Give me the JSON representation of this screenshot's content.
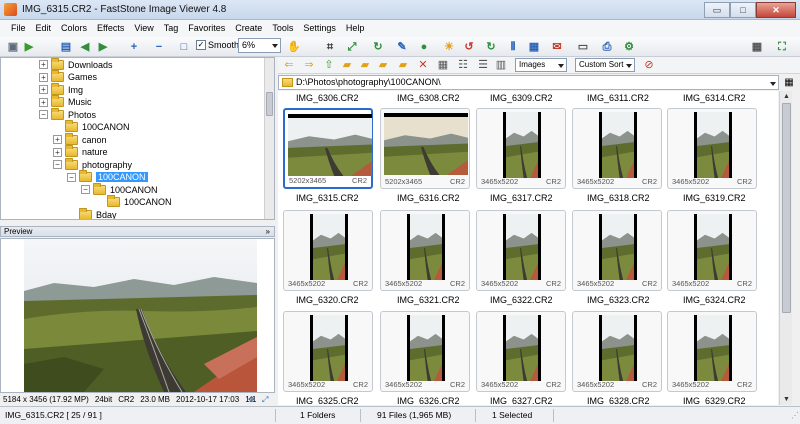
{
  "window": {
    "title": "IMG_6315.CR2  -  FastStone Image Viewer 4.8",
    "controls": {
      "minimize": "▭",
      "maximize": "□",
      "close": "✕"
    }
  },
  "menu": [
    "File",
    "Edit",
    "Colors",
    "Effects",
    "View",
    "Tag",
    "Favorites",
    "Create",
    "Tools",
    "Settings",
    "Help"
  ],
  "toolbar": {
    "smooth_label": "Smooth",
    "smooth_checked": true,
    "zoom_value": "6%"
  },
  "tree": {
    "items": [
      {
        "label": "Downloads",
        "depth": 0,
        "expander": "+"
      },
      {
        "label": "Games",
        "depth": 0,
        "expander": "+"
      },
      {
        "label": "Img",
        "depth": 0,
        "expander": "+"
      },
      {
        "label": "Music",
        "depth": 0,
        "expander": "+"
      },
      {
        "label": "Photos",
        "depth": 0,
        "expander": "−"
      },
      {
        "label": "100CANON",
        "depth": 1,
        "expander": ""
      },
      {
        "label": "canon",
        "depth": 1,
        "expander": "+"
      },
      {
        "label": "nature",
        "depth": 1,
        "expander": "+"
      },
      {
        "label": "photography",
        "depth": 1,
        "expander": "−"
      },
      {
        "label": "100CANON",
        "depth": 2,
        "expander": "−",
        "selected": true
      },
      {
        "label": "100CANON",
        "depth": 3,
        "expander": "−"
      },
      {
        "label": "100CANON",
        "depth": 4,
        "expander": ""
      },
      {
        "label": "Bday",
        "depth": 2,
        "expander": ""
      }
    ]
  },
  "preview": {
    "header": "Preview",
    "collapse_glyph": "»",
    "info": [
      "5184 x 3456 (17.92 MP)",
      "24bit",
      "CR2",
      "23.0 MB",
      "2012-10-17 17:03",
      "1:1"
    ]
  },
  "browser": {
    "filter_value": "Images",
    "sort_value": "Custom Sort",
    "path": "D:\\Photos\\photography\\100CANON\\",
    "top_labels": [
      "IMG_6306.CR2",
      "IMG_6308.CR2",
      "IMG_6309.CR2",
      "IMG_6311.CR2",
      "IMG_6314.CR2"
    ],
    "rows": [
      {
        "cells": [
          {
            "dims": "5202x3465",
            "ext": "CR2",
            "orient": "landscape",
            "selected": true
          },
          {
            "dims": "5202x3465",
            "ext": "CR2",
            "orient": "landscape"
          },
          {
            "dims": "3465x5202",
            "ext": "CR2",
            "orient": "portrait"
          },
          {
            "dims": "3465x5202",
            "ext": "CR2",
            "orient": "portrait"
          },
          {
            "dims": "3465x5202",
            "ext": "CR2",
            "orient": "portrait"
          }
        ],
        "labels": [
          "IMG_6315.CR2",
          "IMG_6316.CR2",
          "IMG_6317.CR2",
          "IMG_6318.CR2",
          "IMG_6319.CR2"
        ]
      },
      {
        "cells": [
          {
            "dims": "3465x5202",
            "ext": "CR2",
            "orient": "portrait"
          },
          {
            "dims": "3465x5202",
            "ext": "CR2",
            "orient": "portrait"
          },
          {
            "dims": "3465x5202",
            "ext": "CR2",
            "orient": "portrait"
          },
          {
            "dims": "3465x5202",
            "ext": "CR2",
            "orient": "portrait"
          },
          {
            "dims": "3465x5202",
            "ext": "CR2",
            "orient": "portrait"
          }
        ],
        "labels": [
          "IMG_6320.CR2",
          "IMG_6321.CR2",
          "IMG_6322.CR2",
          "IMG_6323.CR2",
          "IMG_6324.CR2"
        ]
      },
      {
        "cells": [
          {
            "dims": "3465x5202",
            "ext": "CR2",
            "orient": "portrait"
          },
          {
            "dims": "3465x5202",
            "ext": "CR2",
            "orient": "portrait"
          },
          {
            "dims": "3465x5202",
            "ext": "CR2",
            "orient": "portrait"
          },
          {
            "dims": "3465x5202",
            "ext": "CR2",
            "orient": "portrait"
          },
          {
            "dims": "3465x5202",
            "ext": "CR2",
            "orient": "portrait"
          }
        ],
        "labels": [
          "IMG_6325.CR2",
          "IMG_6326.CR2",
          "IMG_6327.CR2",
          "IMG_6328.CR2",
          "IMG_6329.CR2"
        ]
      }
    ]
  },
  "status": {
    "file": "IMG_6315.CR2 [ 25 / 91 ]",
    "folders": "1 Folders",
    "files": "91 Files (1,965 MB)",
    "selected": "1 Selected"
  },
  "colors": {
    "selection": "#3399ff",
    "thumb_selected_border": "#2a6bd0"
  }
}
